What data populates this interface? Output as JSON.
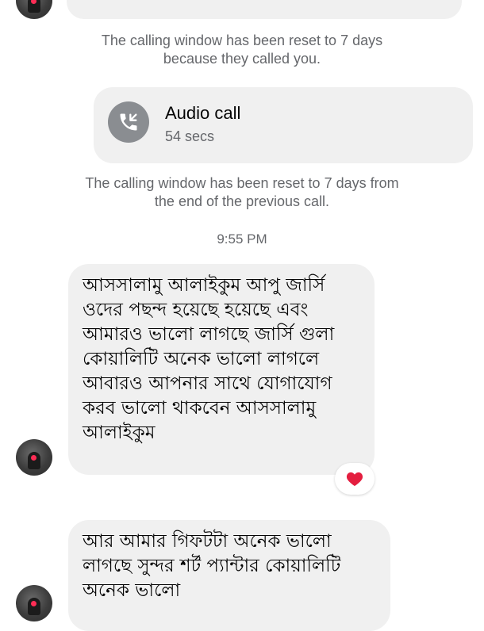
{
  "messages": {
    "notice_1": [
      "The calling window has been reset to 7 days",
      "because they called you."
    ],
    "call": {
      "title": "Audio call",
      "duration": "54 secs",
      "icon": "phone-incoming-icon"
    },
    "notice_2": [
      "The calling window has been reset to 7 days from",
      "the end of the previous call."
    ],
    "timestamp": "9:55 PM",
    "bubble_1": [
      "আসসালামু আলাইকুম আপু জার্সি",
      "ওদের পছন্দ হয়েছে হয়েছে এবং",
      "আমারও ভালো লাগছে জার্সি গুলা",
      "কোয়ালিটি অনেক ভালো লাগলে",
      "আবারও আপনার সাথে যোগাযোগ",
      "করব ভালো থাকবেন আসসালামু",
      "আলাইকুম"
    ],
    "reaction": "heart-reaction-icon",
    "bubble_2": [
      "আর আমার গিফটটা অনেক ভালো",
      "লাগছে সুন্দর শর্ট প্যান্টার কোয়ালিটি",
      "অনেক ভালো"
    ]
  },
  "colors": {
    "bubble_bg": "#f0f0f0",
    "secondary_text": "#65676b",
    "call_icon_bg": "#8a8d91",
    "heart": "#e41e3f"
  }
}
